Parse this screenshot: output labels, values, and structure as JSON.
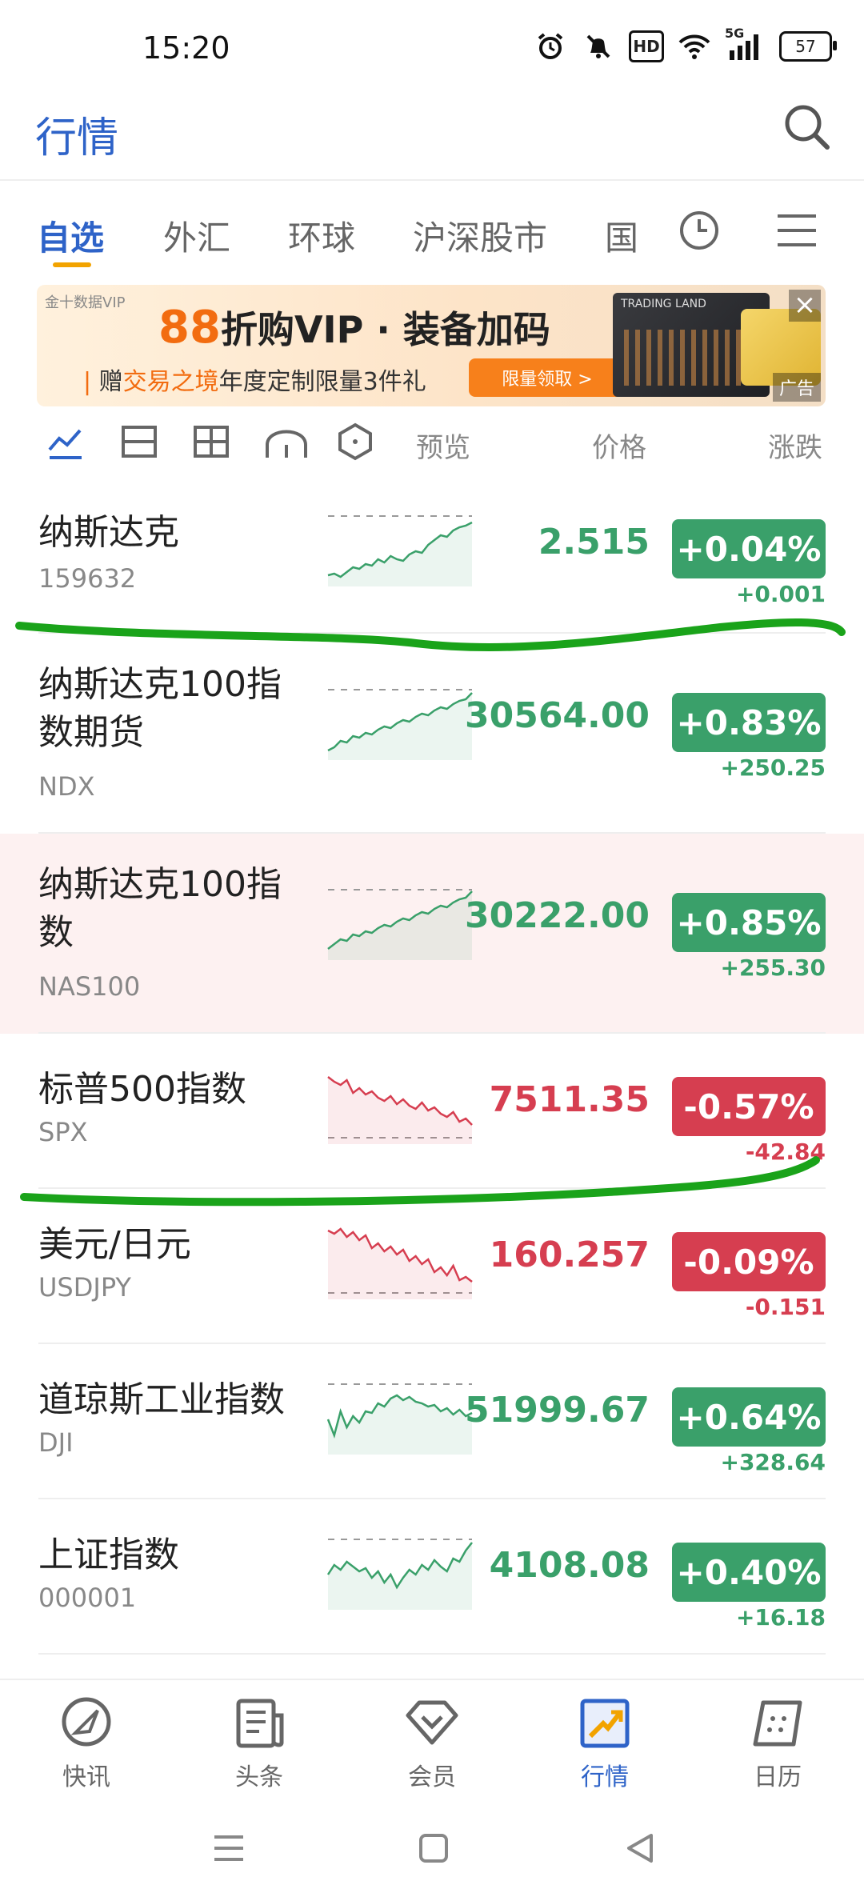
{
  "status_bar": {
    "time": "15:20",
    "icons": [
      "alarm-icon",
      "mute-icon",
      "hd-icon",
      "wifi-icon",
      "signal-5g-icon",
      "battery-icon"
    ],
    "hd_label": "HD",
    "network_label": "5G",
    "battery": "57"
  },
  "header": {
    "title": "行情",
    "search_icon": "search-icon"
  },
  "tabs": [
    {
      "label": "自选",
      "active": true
    },
    {
      "label": "外汇"
    },
    {
      "label": "环球"
    },
    {
      "label": "沪深股市"
    },
    {
      "label": "国"
    }
  ],
  "tab_icons": [
    "clock-icon",
    "menu-icon"
  ],
  "banner": {
    "brand": "金十数据VIP",
    "headline_num": "88",
    "headline_text": "折购VIP · 装备加码",
    "subline_prefix": "赠",
    "subline_highlight": "交易之境",
    "subline_suffix": "年度定制限量3件礼",
    "cta": "限量领取 >",
    "pic_label": "TRADING LAND",
    "ad_label": "广告"
  },
  "column_header": {
    "view_icons": [
      "line-chart-view-icon",
      "card-view-icon",
      "grid-view-icon",
      "curve-view-icon",
      "hex-view-icon"
    ],
    "preview": "预览",
    "price": "价格",
    "change": "涨跌"
  },
  "colors": {
    "accent": "#2e63c8",
    "up": "#3aa06a",
    "down": "#d63e50",
    "highlight_row": "#fdf1f1",
    "marker": "#1aa31a"
  },
  "quotes": [
    {
      "name": "纳斯达克",
      "code": "159632",
      "price": "2.515",
      "change_pct": "+0.04%",
      "change": "+0.001",
      "dir": "up",
      "spark": [
        10,
        12,
        8,
        14,
        20,
        18,
        24,
        22,
        30,
        26,
        34,
        30,
        28,
        36,
        40,
        38,
        48,
        54,
        60,
        58,
        66,
        70,
        72,
        76
      ]
    },
    {
      "name": "纳斯达克100指数期货",
      "code": "NDX",
      "price": "30564.00",
      "change_pct": "+0.83%",
      "change": "+250.25",
      "dir": "up",
      "spark": [
        8,
        12,
        20,
        18,
        26,
        24,
        30,
        28,
        34,
        38,
        36,
        42,
        46,
        44,
        50,
        54,
        52,
        58,
        62,
        60,
        66,
        70,
        72,
        80
      ]
    },
    {
      "name": "纳斯达克100指数",
      "code": "NAS100",
      "price": "30222.00",
      "change_pct": "+0.85%",
      "change": "+255.30",
      "dir": "up",
      "highlight": true,
      "spark": [
        10,
        16,
        22,
        20,
        28,
        26,
        32,
        30,
        36,
        40,
        38,
        44,
        48,
        46,
        52,
        56,
        54,
        60,
        64,
        62,
        68,
        72,
        74,
        82
      ]
    },
    {
      "name": "标普500指数",
      "code": "SPX",
      "price": "7511.35",
      "change_pct": "-0.57%",
      "change": "-42.84",
      "dir": "down",
      "spark": [
        80,
        74,
        70,
        76,
        60,
        66,
        58,
        62,
        54,
        50,
        56,
        46,
        52,
        44,
        40,
        48,
        38,
        42,
        34,
        30,
        36,
        24,
        28,
        20
      ]
    },
    {
      "name": "美元/日元",
      "code": "USDJPY",
      "price": "160.257",
      "change_pct": "-0.09%",
      "change": "-0.151",
      "dir": "down",
      "spark": [
        82,
        78,
        84,
        74,
        80,
        70,
        76,
        60,
        66,
        56,
        62,
        52,
        58,
        44,
        50,
        40,
        46,
        30,
        36,
        26,
        38,
        20,
        24,
        18
      ]
    },
    {
      "name": "道琼斯工业指数",
      "code": "DJI",
      "price": "51999.67",
      "change_pct": "+0.64%",
      "change": "+328.64",
      "dir": "up",
      "spark": [
        40,
        20,
        50,
        30,
        44,
        36,
        50,
        48,
        60,
        56,
        66,
        70,
        64,
        68,
        62,
        60,
        56,
        58,
        50,
        54,
        46,
        52,
        44,
        48
      ]
    },
    {
      "name": "上证指数",
      "code": "000001",
      "price": "4108.08",
      "change_pct": "+0.40%",
      "change": "+16.18",
      "dir": "up",
      "spark": [
        40,
        52,
        46,
        56,
        50,
        44,
        48,
        36,
        44,
        30,
        40,
        24,
        36,
        46,
        40,
        52,
        46,
        58,
        50,
        44,
        60,
        56,
        70,
        80
      ]
    }
  ],
  "bottom_nav": [
    {
      "label": "快讯",
      "icon": "flash-news-icon"
    },
    {
      "label": "头条",
      "icon": "headline-icon"
    },
    {
      "label": "会员",
      "icon": "vip-icon"
    },
    {
      "label": "行情",
      "icon": "market-icon",
      "active": true
    },
    {
      "label": "日历",
      "icon": "calendar-icon"
    }
  ],
  "system_nav": [
    "recents-icon",
    "home-icon",
    "back-icon"
  ]
}
